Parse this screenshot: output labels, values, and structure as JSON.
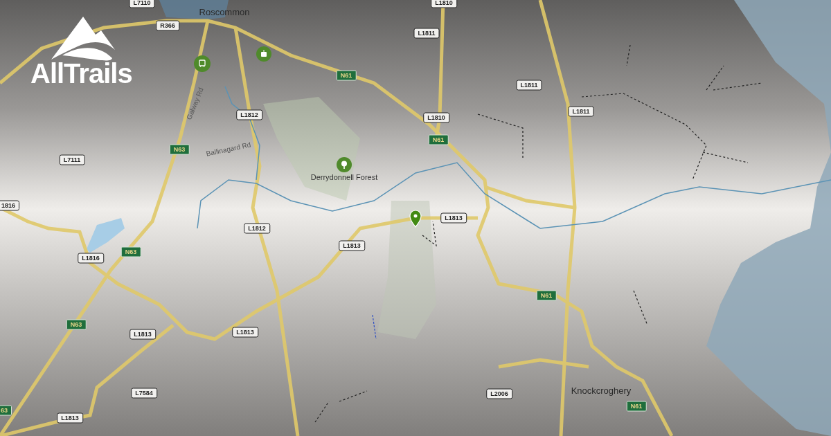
{
  "logo": {
    "text": "AllTrails"
  },
  "places": [
    {
      "text": "Roscommon",
      "kind": "town"
    },
    {
      "text": "Derrydonnell Forest",
      "kind": "poi"
    },
    {
      "text": "Knockcroghery",
      "kind": "town"
    },
    {
      "text": "Galway Rd",
      "kind": "street"
    },
    {
      "text": "Ballinagard Rd",
      "kind": "street"
    }
  ],
  "road_labels": [
    {
      "text": "L7110",
      "kind": "local"
    },
    {
      "text": "R366",
      "kind": "local"
    },
    {
      "text": "L1810",
      "kind": "local"
    },
    {
      "text": "L1811",
      "kind": "local"
    },
    {
      "text": "L1812",
      "kind": "local"
    },
    {
      "text": "L1811",
      "kind": "local"
    },
    {
      "text": "L1810",
      "kind": "local"
    },
    {
      "text": "L1811",
      "kind": "local"
    },
    {
      "text": "L7111",
      "kind": "local"
    },
    {
      "text": "1816",
      "kind": "local"
    },
    {
      "text": "L1812",
      "kind": "local"
    },
    {
      "text": "L1813",
      "kind": "local"
    },
    {
      "text": "L1813",
      "kind": "local"
    },
    {
      "text": "L1816",
      "kind": "local"
    },
    {
      "text": "L1813",
      "kind": "local"
    },
    {
      "text": "L1813",
      "kind": "local"
    },
    {
      "text": "L7584",
      "kind": "local"
    },
    {
      "text": "L2006",
      "kind": "local"
    },
    {
      "text": "L1813",
      "kind": "local"
    },
    {
      "text": "N61",
      "kind": "national"
    },
    {
      "text": "N61",
      "kind": "national"
    },
    {
      "text": "N63",
      "kind": "national"
    },
    {
      "text": "N63",
      "kind": "national"
    },
    {
      "text": "N63",
      "kind": "national"
    },
    {
      "text": "N61",
      "kind": "national"
    },
    {
      "text": "N61",
      "kind": "national"
    },
    {
      "text": "63",
      "kind": "national"
    }
  ]
}
